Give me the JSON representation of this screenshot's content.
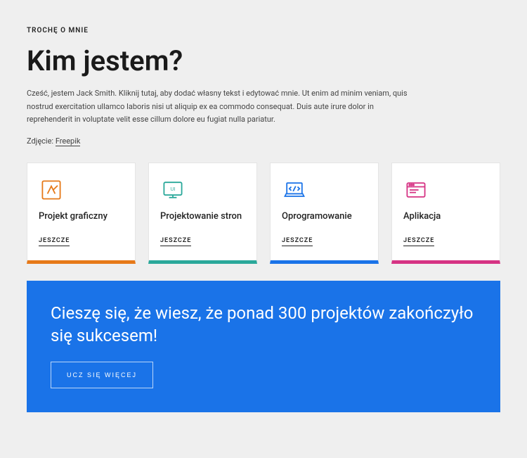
{
  "eyebrow": "TROCHĘ O MNIE",
  "title": "Kim jestem?",
  "body": "Cześć, jestem Jack Smith. Kliknij tutaj, aby dodać własny tekst i edytować mnie. Ut enim ad minim veniam, quis nostrud exercitation ullamco laboris nisi ut aliquip ex ea commodo consequat. Duis aute irure dolor in reprehenderit in voluptate velit esse cillum dolore eu fugiat nulla pariatur.",
  "credit_label": "Zdjęcie: ",
  "credit_link": "Freepik",
  "cards": [
    {
      "title": "Projekt graficzny",
      "link": "JESZCZE",
      "color": "#e67918"
    },
    {
      "title": "Projektowanie stron",
      "link": "JESZCZE",
      "color": "#2aa89a"
    },
    {
      "title": "Oprogramowanie",
      "link": "JESZCZE",
      "color": "#1a73e8"
    },
    {
      "title": "Aplikacja",
      "link": "JESZCZE",
      "color": "#d63384"
    }
  ],
  "cta": {
    "heading": "Cieszę się, że wiesz, że ponad 300 projektów zakończyło się sukcesem!",
    "button": "UCZ SIĘ WIĘCEJ"
  }
}
